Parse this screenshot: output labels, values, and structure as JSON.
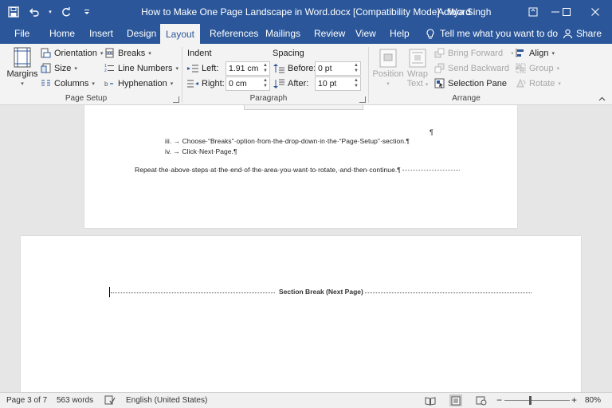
{
  "titlebar": {
    "title": "How to Make One Page Landscape in Word.docx [Compatibility Mode]  -  Word",
    "user": "Aditya Singh"
  },
  "tabs": [
    "File",
    "Home",
    "Insert",
    "Design",
    "Layout",
    "References",
    "Mailings",
    "Review",
    "View",
    "Help"
  ],
  "active_tab": "Layout",
  "tell_me": "Tell me what you want to do",
  "share": "Share",
  "page_setup": {
    "margins": "Margins",
    "orientation": "Orientation",
    "size": "Size",
    "columns": "Columns",
    "breaks": "Breaks",
    "line_numbers": "Line Numbers",
    "hyphenation": "Hyphenation",
    "group_label": "Page Setup"
  },
  "paragraph": {
    "indent_label": "Indent",
    "spacing_label": "Spacing",
    "left_label": "Left:",
    "left_value": "1.91 cm",
    "right_label": "Right:",
    "right_value": "0 cm",
    "before_label": "Before:",
    "before_value": "0 pt",
    "after_label": "After:",
    "after_value": "10 pt",
    "group_label": "Paragraph"
  },
  "arrange": {
    "position": "Position",
    "wrap_text_1": "Wrap",
    "wrap_text_2": "Text",
    "bring_forward": "Bring Forward",
    "send_backward": "Send Backward",
    "selection_pane": "Selection Pane",
    "align": "Align",
    "group": "Group",
    "rotate": "Rotate",
    "group_label": "Arrange"
  },
  "document": {
    "list_item_3": "iii. →  Choose·“Breaks”·option·from·the·drop-down·in·the·“Page·Setup”·section.¶",
    "list_item_4": "iv. →  Click·Next·Page.¶",
    "repeat_text": "Repeat·the·above·steps·at·the·end·of·the·area·you·want·to·rotate,·and·then·continue.¶",
    "pilcrow": "¶",
    "section_break": "Section Break (Next Page)"
  },
  "status": {
    "page": "Page 3 of 7",
    "words": "563 words",
    "language": "English (United States)",
    "zoom": "80%",
    "zoom_value": 80
  },
  "colors": {
    "accent": "#2b579a",
    "ribbon_bg": "#f3f3f3",
    "doc_bg": "#e6e6e6"
  }
}
